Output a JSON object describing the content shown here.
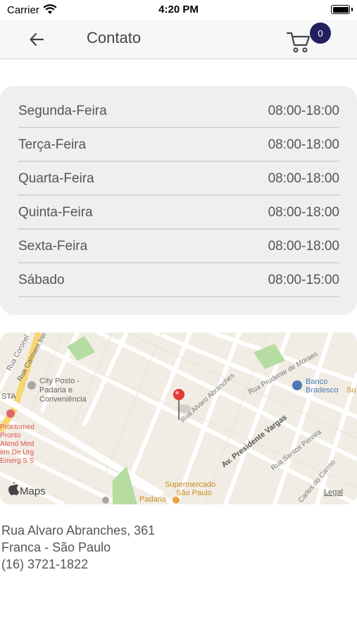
{
  "status_bar": {
    "carrier": "Carrier",
    "time": "4:20 PM"
  },
  "header": {
    "title": "Contato",
    "cart_count": "0"
  },
  "hours": [
    {
      "day": "Segunda-Feira",
      "time": "08:00-18:00"
    },
    {
      "day": "Terça-Feira",
      "time": "08:00-18:00"
    },
    {
      "day": "Quarta-Feira",
      "time": "08:00-18:00"
    },
    {
      "day": "Quinta-Feira",
      "time": "08:00-18:00"
    },
    {
      "day": "Sexta-Feira",
      "time": "08:00-18:00"
    },
    {
      "day": "Sábado",
      "time": "08:00-15:00"
    }
  ],
  "map": {
    "brand": "Maps",
    "legal": "Legal",
    "labels": {
      "city_posto": [
        "City Posto -",
        "Padaria e",
        "Conveniência"
      ],
      "rua_coronel": "Rua Coronel",
      "rua_carmem": "Rua Carmem Irer",
      "rua_alvaro": "Rua Alvaro Abranches",
      "rua_prudente": "Rua Prudente de Moraes",
      "banco": [
        "Banco",
        "Bradesco"
      ],
      "av_presidente": "Av. Presidente Vargas",
      "rua_santos": "Rua Santos Pereira",
      "carlos_carmo": "Carlos do Carmo",
      "supermercado": [
        "Supermercado",
        "São Paulo"
      ],
      "padaria": "Padaria",
      "prontomed": [
        "Prontomed",
        "Pronto",
        "Atend Med",
        "em De Urg",
        "Emerg S S"
      ],
      "sta": "STA",
      "su": "Su"
    }
  },
  "address": {
    "street": "Rua Alvaro Abranches, 361",
    "city": "Franca - São Paulo",
    "phone": "(16) 3721-1822"
  },
  "colors": {
    "badge": "#231f5e",
    "pin": "#e53935",
    "park": "#b5dca1",
    "poi_orange": "#e8a33d",
    "poi_red": "#e06666",
    "bank_blue": "#4a78b8"
  }
}
